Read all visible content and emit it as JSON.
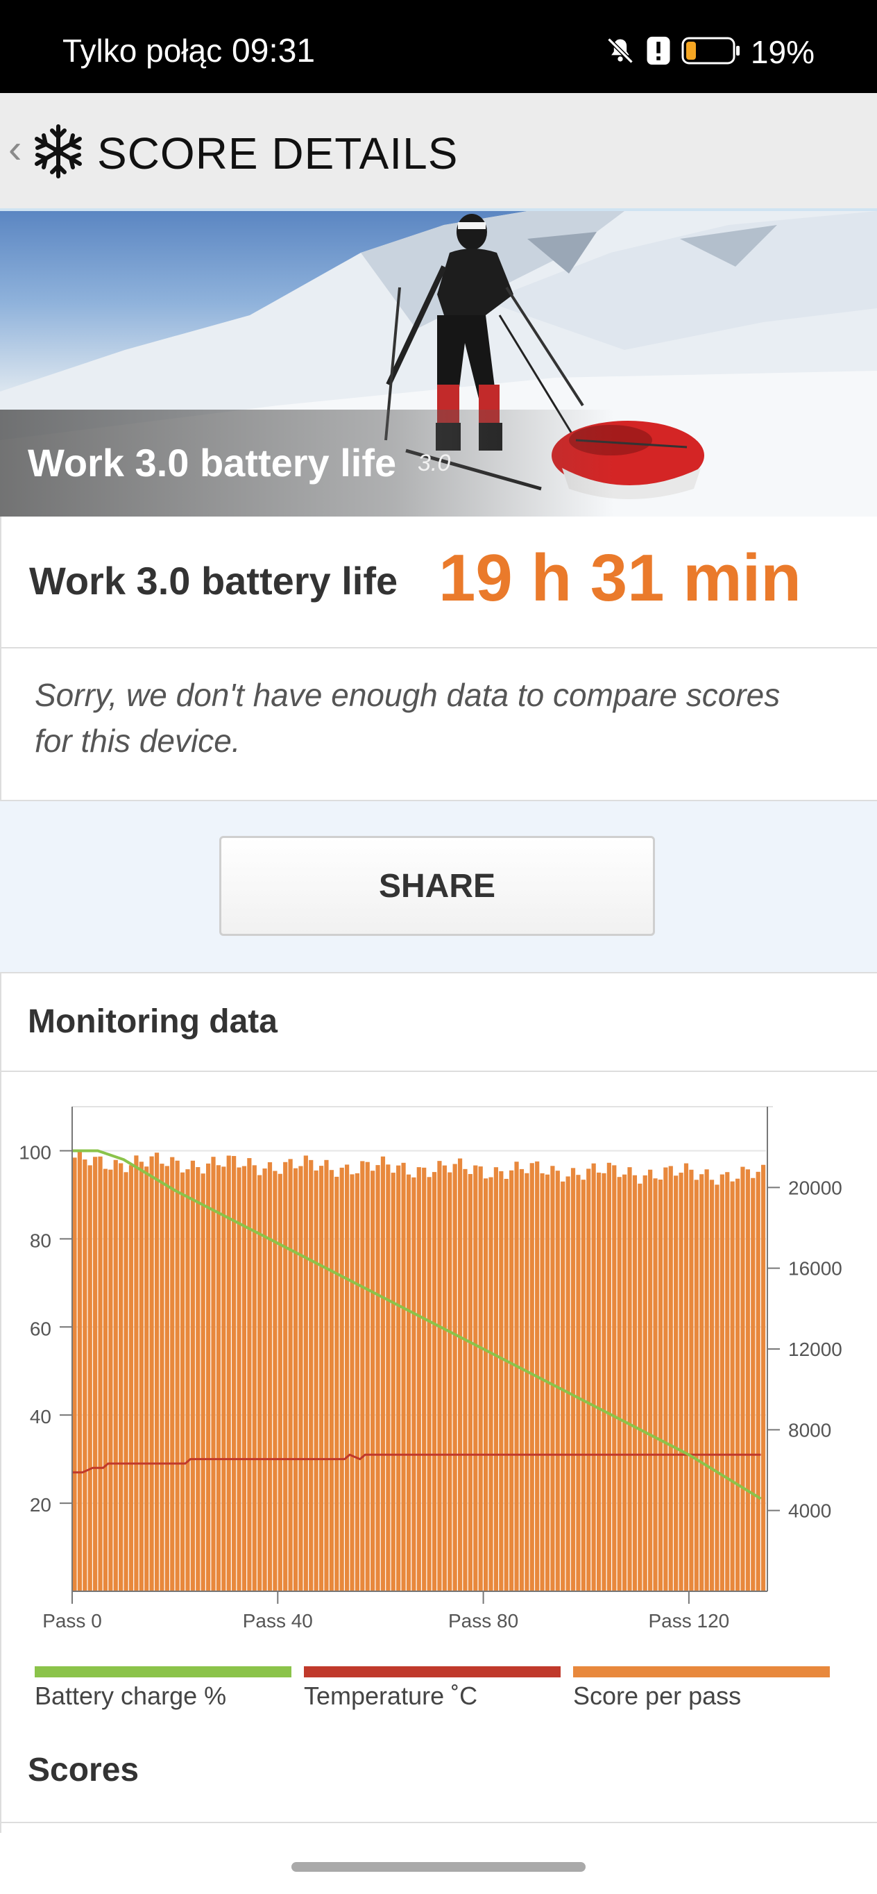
{
  "status_bar": {
    "carrier": "Tylko połąc",
    "time": "09:31",
    "battery_percent": "19%",
    "battery_level": 0.19,
    "icons": [
      "bell-muted-icon",
      "alert-icon",
      "battery-icon"
    ]
  },
  "app_bar": {
    "back_icon": "chevron-left-icon",
    "logo_icon": "snowflake-icon",
    "title": "SCORE DETAILS"
  },
  "hero": {
    "title": "Work 3.0 battery life",
    "version": "3.0"
  },
  "score": {
    "label": "Work 3.0 battery life",
    "value": "19 h 31 min",
    "value_color": "#ea7a2b"
  },
  "compare_note": "Sorry, we don't have enough data to compare scores for this device.",
  "share_label": "SHARE",
  "monitoring": {
    "title": "Monitoring data",
    "legend": [
      {
        "label": "Battery charge %",
        "color": "#8bc34a"
      },
      {
        "label": "Temperature ˚C",
        "color": "#c0392b"
      },
      {
        "label": "Score per pass",
        "color": "#e8883c"
      }
    ]
  },
  "scores_title": "Scores",
  "chart_data": {
    "type": "bar",
    "x_ticks": [
      "Pass 0",
      "Pass 40",
      "Pass 80",
      "Pass 120"
    ],
    "x_tick_values": [
      0,
      40,
      80,
      120
    ],
    "xlim": [
      0,
      135
    ],
    "left_axis": {
      "ylim": [
        0,
        110
      ],
      "ticks": [
        20,
        40,
        60,
        80,
        100
      ]
    },
    "right_axis": {
      "ylim": [
        0,
        24000
      ],
      "ticks": [
        4000,
        8000,
        12000,
        16000,
        20000
      ]
    },
    "series": [
      {
        "name": "Score per pass",
        "axis": "right",
        "type": "bar",
        "count": 135,
        "values_approx": "≈20700–21500 per pass, gradually declining to ≈20600 by pass 134"
      },
      {
        "name": "Battery charge %",
        "axis": "left",
        "type": "line",
        "points": [
          [
            0,
            100
          ],
          [
            5,
            100
          ],
          [
            10,
            98
          ],
          [
            20,
            91
          ],
          [
            40,
            79
          ],
          [
            60,
            67
          ],
          [
            80,
            55
          ],
          [
            100,
            43
          ],
          [
            120,
            31
          ],
          [
            134,
            21
          ]
        ]
      },
      {
        "name": "Temperature ˚C",
        "axis": "left",
        "type": "line",
        "points": [
          [
            0,
            27
          ],
          [
            2,
            27
          ],
          [
            4,
            28
          ],
          [
            6,
            28
          ],
          [
            7,
            29
          ],
          [
            22,
            29
          ],
          [
            23,
            30
          ],
          [
            53,
            30
          ],
          [
            54,
            31
          ],
          [
            55,
            30.5
          ],
          [
            56,
            30
          ],
          [
            57,
            31
          ],
          [
            134,
            31
          ]
        ]
      }
    ],
    "grid": true,
    "legend_position": "bottom"
  }
}
